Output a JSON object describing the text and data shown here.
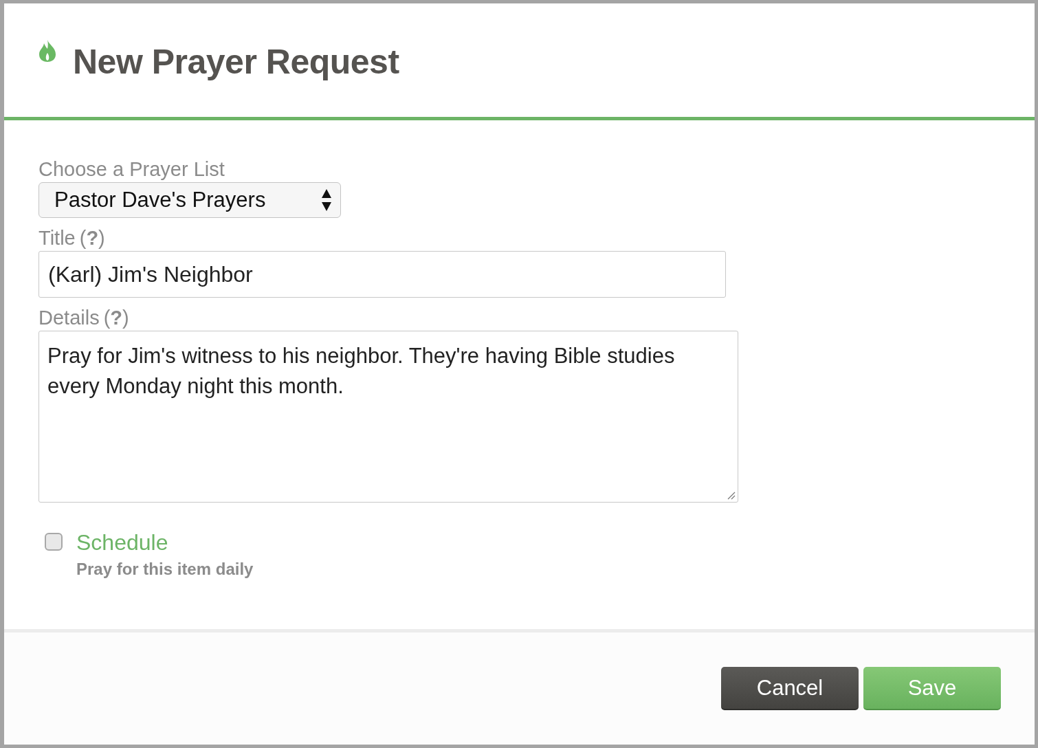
{
  "dialog": {
    "title": "New Prayer Request"
  },
  "fields": [
    {
      "kind": "select",
      "label": "Choose a Prayer List",
      "value": "Pastor Dave's Prayers"
    },
    {
      "kind": "text",
      "label": "Title",
      "help": "(**?**)",
      "value": "(Karl) Jim's Neighbor"
    },
    {
      "kind": "textarea",
      "label": "Details",
      "help": "(**?**)",
      "value": "Pray for Jim's witness to his neighbor. They're having Bible studies every Monday night this month."
    }
  ],
  "schedule": {
    "label": "Schedule",
    "checked": false,
    "hint": "Pray for this item daily"
  },
  "buttons": [
    {
      "kind": "cancel",
      "label": "Cancel"
    },
    {
      "kind": "save",
      "label": "Save"
    }
  ]
}
